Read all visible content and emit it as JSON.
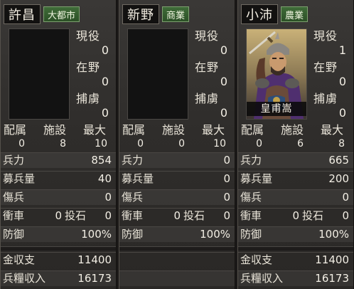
{
  "labels": {
    "active": "現役",
    "unemployed": "在野",
    "captive": "捕虜",
    "assigned": "配属",
    "facilities": "施設",
    "max": "最大",
    "troops": "兵力",
    "recruits": "募兵量",
    "wounded": "傷兵",
    "ram": "衝車",
    "catapult": "投石",
    "defense": "防御",
    "gold_income": "金収支",
    "food_income": "兵糧収入"
  },
  "cities": [
    {
      "name": "許昌",
      "type": "大都市",
      "active": "0",
      "unemployed": "0",
      "captive": "0",
      "assigned": "0",
      "facilities": "8",
      "max": "10",
      "troops": "854",
      "recruits": "40",
      "wounded": "0",
      "ram": "0",
      "catapult": "0",
      "defense": "100%",
      "gold_income": "11400",
      "food_income": "16173"
    },
    {
      "name": "新野",
      "type": "商業",
      "active": "0",
      "unemployed": "0",
      "captive": "0",
      "assigned": "0",
      "facilities": "0",
      "max": "10",
      "troops": "0",
      "recruits": "0",
      "wounded": "0",
      "ram": "0",
      "catapult": "0",
      "defense": "100%",
      "gold_income": "",
      "food_income": ""
    },
    {
      "name": "小沛",
      "type": "農業",
      "general": "皇甫嵩",
      "active": "1",
      "unemployed": "0",
      "captive": "0",
      "assigned": "0",
      "facilities": "6",
      "max": "8",
      "troops": "665",
      "recruits": "200",
      "wounded": "0",
      "ram": "0",
      "catapult": "0",
      "defense": "100%",
      "gold_income": "11400",
      "food_income": "16173"
    }
  ],
  "colors": {
    "type_badge": "#2c5127",
    "panel_bg": "#2f2d2b"
  }
}
